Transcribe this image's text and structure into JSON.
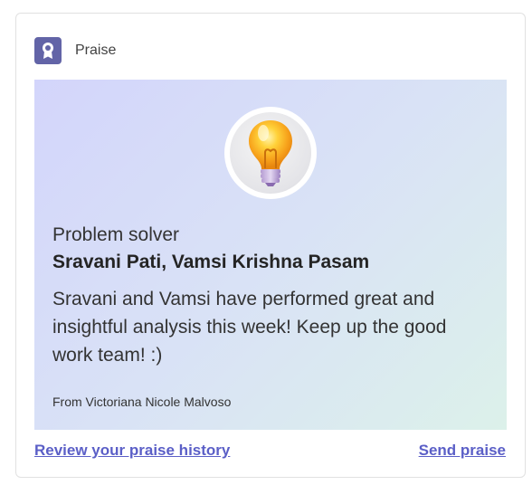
{
  "header": {
    "title": "Praise",
    "icon": "ribbon-award-icon",
    "icon_color": "#6264a7"
  },
  "praise": {
    "badge_icon": "lightbulb-icon",
    "category": "Problem solver",
    "recipients": "Sravani Pati, Vamsi Krishna Pasam",
    "message": "Sravani and Vamsi have performed great and insightful analysis this week! Keep up the good work team! :)",
    "from": "From Victoriana Nicole Malvoso"
  },
  "actions": {
    "history_label": "Review your praise history",
    "send_label": "Send praise",
    "link_color": "#5b5fc7"
  }
}
